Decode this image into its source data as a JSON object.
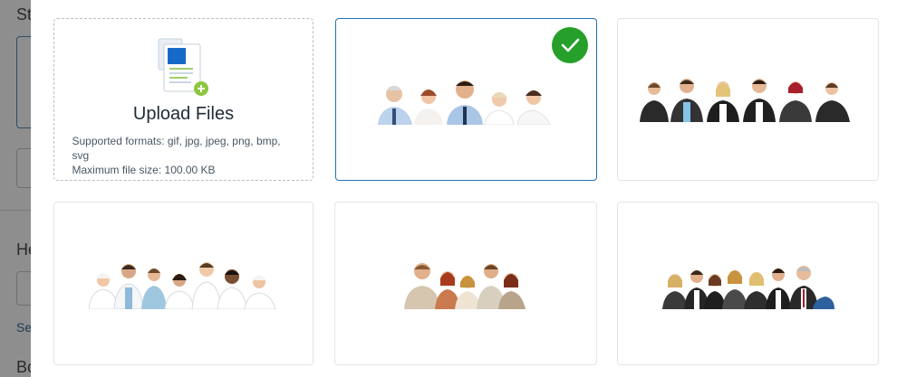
{
  "background_page": {
    "fragment_1": "St",
    "fragment_2": "He",
    "fragment_3": "Se",
    "fragment_4": "Bo"
  },
  "image_picker": {
    "upload": {
      "title": "Upload Files",
      "formats": "Supported formats: gif, jpg, jpeg, png, bmp, svg",
      "max_size": "Maximum file size: 100.00 KB",
      "icon": "document-add-icon"
    },
    "images": [
      {
        "name": "team-business-casual",
        "selected": true
      },
      {
        "name": "team-business-formal",
        "selected": false
      },
      {
        "name": "team-medical",
        "selected": false
      },
      {
        "name": "team-casual",
        "selected": false
      },
      {
        "name": "team-corporate",
        "selected": false
      }
    ],
    "selected_icon": "checkmark-icon",
    "colors": {
      "accent": "#1f6fb5",
      "selected_check": "#26a02a"
    }
  }
}
